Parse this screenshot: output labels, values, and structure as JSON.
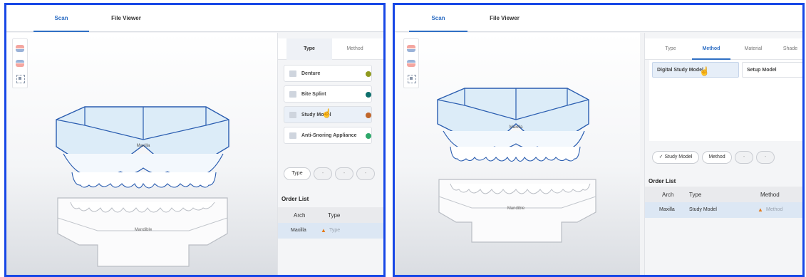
{
  "left": {
    "nav": {
      "scan": "Scan",
      "file_viewer": "File Viewer"
    },
    "tabs": {
      "type": "Type",
      "method": "Method"
    },
    "type_items": [
      {
        "label": "Denture",
        "color": "#8f9a1f"
      },
      {
        "label": "Bite Splint",
        "color": "#0e6f6c"
      },
      {
        "label": "Study Model",
        "color": "#c0662a"
      },
      {
        "label": "Anti-Snoring Appliance",
        "color": "#2ea86a"
      }
    ],
    "chips": {
      "type": "Type",
      "dash1": "-",
      "dash2": "-",
      "dash3": "-"
    },
    "order_list": {
      "title": "Order List",
      "headers": {
        "arch": "Arch",
        "type": "Type"
      },
      "row": {
        "arch": "Maxilla",
        "type": "Type"
      }
    },
    "arches": {
      "upper": "Maxilla",
      "lower": "Mandible"
    }
  },
  "right": {
    "nav": {
      "scan": "Scan",
      "file_viewer": "File Viewer"
    },
    "tabs": {
      "type": "Type",
      "method": "Method",
      "material": "Material",
      "shade": "Shade"
    },
    "methods": {
      "digital": "Digital Study Model",
      "setup": "Setup Model"
    },
    "chips": {
      "study": "Study Model",
      "method": "Method",
      "dash1": "-",
      "dash2": "-"
    },
    "order_list": {
      "title": "Order List",
      "headers": {
        "arch": "Arch",
        "type": "Type",
        "method": "Method"
      },
      "row": {
        "arch": "Maxilla",
        "type": "Study Model",
        "method": "Method"
      }
    },
    "arches": {
      "upper": "Maxilla",
      "lower": "Mandible"
    }
  },
  "colors": {
    "frame_border": "#1747e6",
    "accent": "#2f6fc4",
    "warning": "#e47a1a",
    "row_selected": "#dce7f4"
  },
  "icons": {
    "upper_jaw": "upper-jaw-icon",
    "lower_jaw": "lower-jaw-icon",
    "fit_view": "fit-view-icon",
    "warning": "warning-icon",
    "check": "check-icon",
    "cursor": "hand-cursor-icon"
  }
}
